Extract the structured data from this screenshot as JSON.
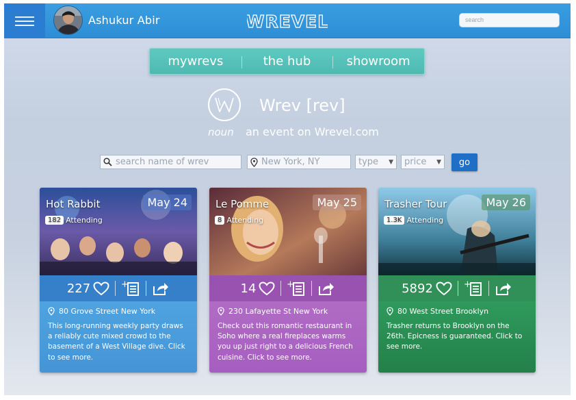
{
  "header": {
    "username": "Ashukur Abir",
    "logo_text": "WREVEL",
    "search_placeholder": "search"
  },
  "nav": {
    "tabs": [
      {
        "label": "mywrevs"
      },
      {
        "label": "the hub"
      },
      {
        "label": "showroom"
      }
    ]
  },
  "definition": {
    "word": "Wrev [rev]",
    "part_of_speech": "noun",
    "meaning": "an event on Wrevel.com"
  },
  "filters": {
    "name_placeholder": "search name of wrev",
    "location_value": "New York, NY",
    "type_label": "type",
    "price_label": "price",
    "go_label": "go"
  },
  "events": [
    {
      "title": "Hot Rabbit",
      "date": "May 24",
      "attending_count": "182",
      "attending_label": "Attending",
      "likes": "227",
      "address": "80 Grove Street New York",
      "description": "This long-running weekly party draws a reliably cute mixed crowd to the basement of a West Village dive. Click to see more.",
      "theme_color": "#3f8fd6"
    },
    {
      "title": "Le Pomme",
      "date": "May 25",
      "attending_count": "8",
      "attending_label": "Attending",
      "likes": "14",
      "address": "230 Lafayette St New York",
      "description": "Check out this romantic restaurant in Soho where a real fireplaces warms you up just right to a delicious French cuisine. Click to see more.",
      "theme_color": "#a65ec0"
    },
    {
      "title": "Trasher Tour",
      "date": "May 26",
      "attending_count": "1.3K",
      "attending_label": "Attending",
      "likes": "5892",
      "address": "80 West Street Brooklyn",
      "description": "Trasher returns to Brooklyn on the 26th. Epicness is guaranteed. Click to see more.",
      "theme_color": "#238049"
    }
  ]
}
